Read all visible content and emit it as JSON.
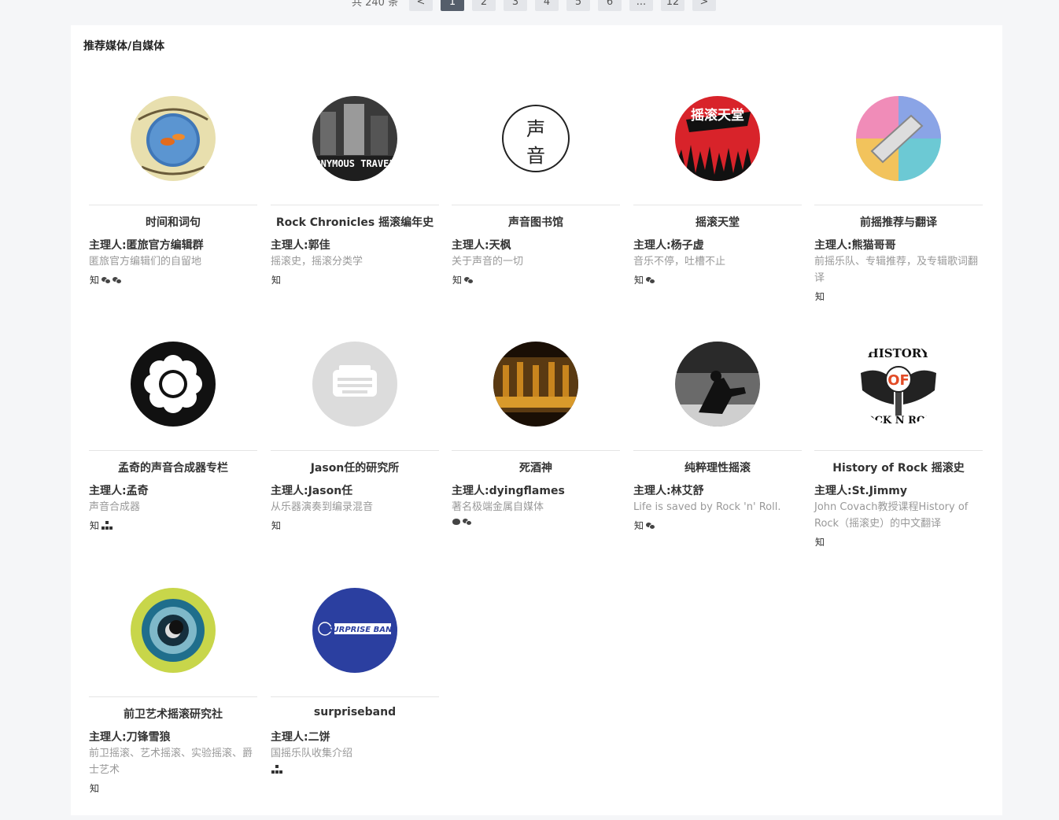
{
  "pagination": {
    "total_text": "共 240 条",
    "prev_label": "<",
    "next_label": ">",
    "pages": [
      "1",
      "2",
      "3",
      "4",
      "5",
      "6",
      "...",
      "12"
    ],
    "active_page": "1"
  },
  "section": {
    "title": "推荐媒体/自媒体"
  },
  "cards": [
    {
      "name": "时间和词句",
      "owner": "主理人:匿旅官方编辑群",
      "desc": "匿旅官方编辑们的自留地",
      "icons": [
        "知",
        "wechat",
        "wechat"
      ]
    },
    {
      "name": "Rock Chronicles 摇滚编年史",
      "owner": "主理人:郭佳",
      "desc": "摇滚史，摇滚分类学",
      "icons": [
        "知"
      ]
    },
    {
      "name": "声音图书馆",
      "owner": "主理人:天枫",
      "desc": "关于声音的一切",
      "icons": [
        "知",
        "wechat"
      ]
    },
    {
      "name": "摇滚天堂",
      "owner": "主理人:杨子虚",
      "desc": "音乐不停，吐槽不止",
      "icons": [
        "知",
        "wechat"
      ]
    },
    {
      "name": "前摇推荐与翻译",
      "owner": "主理人:熊猫哥哥",
      "desc": "前摇乐队、专辑推荐，及专辑歌词翻译",
      "icons": [
        "知"
      ]
    },
    {
      "name": "孟奇的声音合成器专栏",
      "owner": "主理人:孟奇",
      "desc": "声音合成器",
      "icons": [
        "知",
        "tree"
      ]
    },
    {
      "name": "Jason任的研究所",
      "owner": "主理人:Jason任",
      "desc": "从乐器演奏到编录混音",
      "icons": [
        "知"
      ]
    },
    {
      "name": "死酒神",
      "owner": "主理人:dyingflames",
      "desc": "著名极端金属自媒体",
      "icons": [
        "weibo",
        "wechat"
      ]
    },
    {
      "name": "纯粹理性摇滚",
      "owner": "主理人:林艾舒",
      "desc": "Life is saved by Rock 'n' Roll.",
      "icons": [
        "知",
        "wechat"
      ]
    },
    {
      "name": "History of Rock 摇滚史",
      "owner": "主理人:St.Jimmy",
      "desc": "John Covach教授课程History of Rock（摇滚史）的中文翻译",
      "icons": [
        "知"
      ]
    },
    {
      "name": "前卫艺术摇滚研究社",
      "owner": "主理人:刀锋雪狼",
      "desc": "前卫摇滚、艺术摇滚、实验摇滚、爵士艺术",
      "icons": [
        "知"
      ]
    },
    {
      "name": "surpriseband",
      "owner": "主理人:二饼",
      "desc": "国摇乐队收集介绍",
      "icons": [
        "tree"
      ]
    }
  ],
  "avatar_text": {
    "avatar_2": "ANONYMOUS TRAVELER",
    "avatar_3_top": "声",
    "avatar_3_bottom": "音",
    "avatar_4": "摇滚天堂",
    "avatar_10_top": "HISTORY",
    "avatar_10_mid": "OF",
    "avatar_10_bottom": "ROCK N ROLL",
    "avatar_12": "SURPRISE BAND"
  },
  "colors": {
    "accent_dark": "#555e6b",
    "desc_gray": "#999999",
    "red": "#d8232a",
    "blue": "#2b3fa0"
  }
}
